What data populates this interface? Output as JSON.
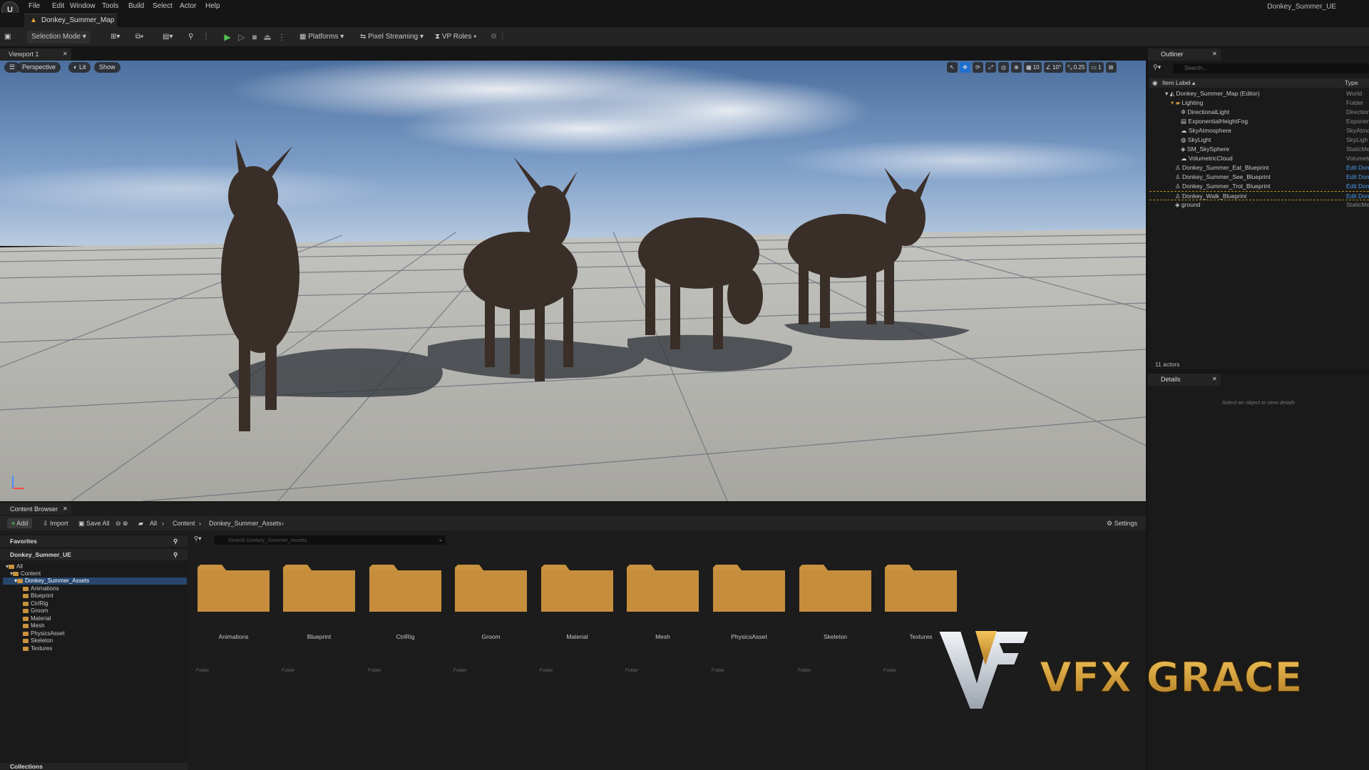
{
  "menubar": {
    "logo": "U",
    "items": [
      "File",
      "Edit",
      "Window",
      "Tools",
      "Build",
      "Select",
      "Actor",
      "Help"
    ],
    "project_name": "Donkey_Summer_UE"
  },
  "level_tab": {
    "label": "Donkey_Summer_Map"
  },
  "toolbar": {
    "selection_mode": "Selection Mode",
    "platforms": "Platforms",
    "pixel_streaming": "Pixel Streaming",
    "vp_roles": "VP Roles"
  },
  "viewport": {
    "tab_label": "Viewport 1",
    "perspective": "Perspective",
    "lit": "Lit",
    "show": "Show",
    "grid_snap": "10",
    "rotation_snap": "10°",
    "scale_snap": "0.25",
    "camera_speed": "1"
  },
  "outliner": {
    "tab_label": "Outliner",
    "search_placeholder": "Search...",
    "col_label": "Item Label ▴",
    "col_type": "Type",
    "rows": [
      {
        "label": "Donkey_Summer_Map (Editor)",
        "type": "World"
      },
      {
        "label": "Lighting",
        "type": "Folder"
      },
      {
        "label": "DirectionalLight",
        "type": "Directiona"
      },
      {
        "label": "ExponentialHeightFog",
        "type": "Exponen"
      },
      {
        "label": "SkyAtmosphere",
        "type": "SkyAtmo"
      },
      {
        "label": "SkyLight",
        "type": "SkyLigh"
      },
      {
        "label": "SM_SkySphere",
        "type": "StaticMe"
      },
      {
        "label": "VolumetricCloud",
        "type": "Volumetr"
      },
      {
        "label": "Donkey_Summer_Eat_Blueprint",
        "type": "Edit Don"
      },
      {
        "label": "Donkey_Summer_See_Blueprint",
        "type": "Edit Don"
      },
      {
        "label": "Donkey_Summer_Trot_Blueprint",
        "type": "Edit Don"
      },
      {
        "label": "Donkey_Walk_Blueprint",
        "type": "Edit Don"
      },
      {
        "label": "ground",
        "type": "StaticMe"
      }
    ],
    "actor_count": "11 actors"
  },
  "details": {
    "tab_label": "Details",
    "empty_text": "Select an object to view details"
  },
  "content_browser": {
    "tab_label": "Content Browser",
    "add": "Add",
    "import": "Import",
    "save_all": "Save All",
    "path": [
      "All",
      "Content",
      "Donkey_Summer_Assets"
    ],
    "settings": "Settings",
    "favorites": "Favorites",
    "project_root": "Donkey_Summer_UE",
    "tree": [
      "All",
      "Content",
      "Donkey_Summer_Assets",
      "Animations",
      "Blueprint",
      "CtrlRig",
      "Groom",
      "Material",
      "Mesh",
      "PhysicsAsset",
      "Skeleton",
      "Textures"
    ],
    "search_placeholder": "Search Donkey_Summer_Assets",
    "folders": [
      {
        "name": "Animations",
        "kind": "Folder"
      },
      {
        "name": "Blueprint",
        "kind": "Folder"
      },
      {
        "name": "CtrlRig",
        "kind": "Folder"
      },
      {
        "name": "Groom",
        "kind": "Folder"
      },
      {
        "name": "Material",
        "kind": "Folder"
      },
      {
        "name": "Mesh",
        "kind": "Folder"
      },
      {
        "name": "PhysicsAsset",
        "kind": "Folder"
      },
      {
        "name": "Skeleton",
        "kind": "Folder"
      },
      {
        "name": "Textures",
        "kind": "Folder"
      }
    ],
    "collections": "Collections"
  },
  "watermark": {
    "text": "VFX GRACE"
  },
  "colors": {
    "panel_bg": "#1a1a1a",
    "toolbar_bg": "#242424",
    "selection_blue": "#26466e",
    "folder_tan": "#c9923e",
    "play_green": "#4fc24f",
    "link_blue": "#4a9ae8"
  }
}
